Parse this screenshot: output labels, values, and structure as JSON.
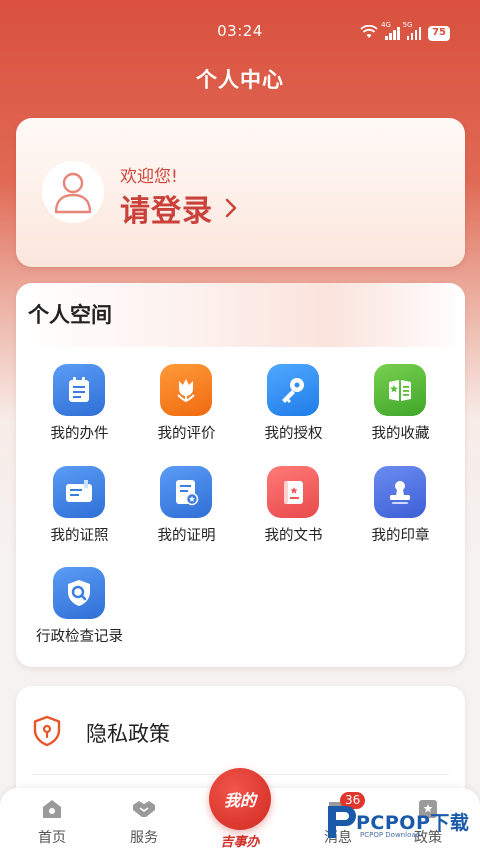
{
  "status_bar": {
    "time": "03:24",
    "signal1_tag": "4G",
    "signal2_tag": "5G",
    "battery": "75"
  },
  "header": {
    "title": "个人中心"
  },
  "login": {
    "welcome": "欢迎您!",
    "action": "请登录"
  },
  "personal_space": {
    "title": "个人空间",
    "items": [
      {
        "label": "我的办件",
        "icon": "clipboard-icon",
        "color": "#3b7de0"
      },
      {
        "label": "我的评价",
        "icon": "tulip-icon",
        "color": "#f57a1c"
      },
      {
        "label": "我的授权",
        "icon": "key-icon",
        "color": "#2f8ff0"
      },
      {
        "label": "我的收藏",
        "icon": "bookmark-icon",
        "color": "#5cbf3a"
      },
      {
        "label": "我的证照",
        "icon": "license-icon",
        "color": "#3b7de0"
      },
      {
        "label": "我的证明",
        "icon": "certificate-icon",
        "color": "#3b7de0"
      },
      {
        "label": "我的文书",
        "icon": "document-icon",
        "color": "#f0565a"
      },
      {
        "label": "我的印章",
        "icon": "stamp-icon",
        "color": "#4a6fe0"
      },
      {
        "label": "行政检查记录",
        "icon": "shield-search-icon",
        "color": "#3b7de0"
      }
    ]
  },
  "privacy": {
    "label": "隐私政策",
    "icon": "shield-icon"
  },
  "tabbar": {
    "items": [
      {
        "label": "首页",
        "icon": "home-icon"
      },
      {
        "label": "服务",
        "icon": "handshake-icon"
      },
      {
        "label": "消息",
        "icon": "message-icon"
      },
      {
        "label": "政策",
        "icon": "policy-icon"
      }
    ],
    "center_label": "我的",
    "center_sub": "吉事办",
    "message_badge": "36"
  },
  "watermark": {
    "text": "PCPOP下载",
    "sub": "PCPOP Download"
  },
  "colors": {
    "brand_red": "#d9503e",
    "accent_red": "#c9413a"
  }
}
